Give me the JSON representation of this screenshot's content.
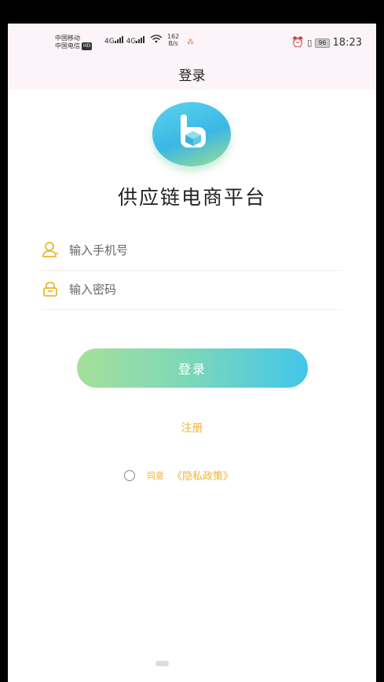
{
  "status_bar": {
    "carrier_1": "中国移动",
    "carrier_2": "中国电信",
    "hd_badge": "HD",
    "signal_label": "4G",
    "speed_value": "162",
    "speed_unit": "B/s",
    "battery": "96",
    "time": "18:23"
  },
  "header": {
    "title": "登录"
  },
  "app": {
    "name": "供应链电商平台"
  },
  "form": {
    "phone_placeholder": "输入手机号",
    "phone_value": "",
    "password_placeholder": "输入密码",
    "password_value": ""
  },
  "actions": {
    "login_label": "登录",
    "register_label": "注册"
  },
  "agreement": {
    "agree_label": "同意",
    "policy_label": "《隐私政策》",
    "checked": false
  },
  "colors": {
    "accent": "#f1b431",
    "button_start": "#a6df9b",
    "button_end": "#42c6ea",
    "status_bar_bg": "#fcf4f8"
  }
}
